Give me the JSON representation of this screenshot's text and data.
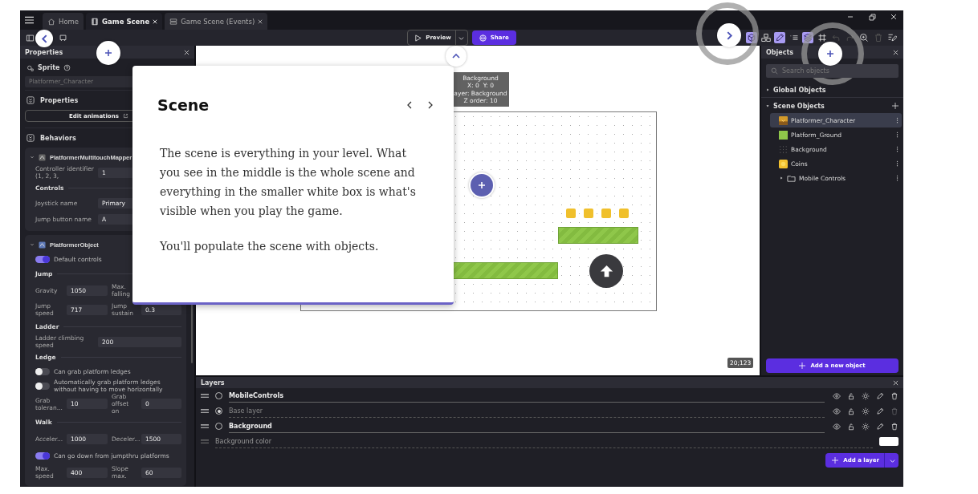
{
  "tabs": [
    {
      "label": "Home",
      "selected": false,
      "closable": false
    },
    {
      "label": "Game Scene",
      "selected": true,
      "closable": true
    },
    {
      "label": "Game Scene (Events)",
      "selected": false,
      "closable": true
    }
  ],
  "toolbar": {
    "preview_label": "Preview",
    "share_label": "Share",
    "tools": [
      {
        "active": true,
        "disabled": false
      },
      {
        "active": false,
        "disabled": false
      },
      {
        "active": true,
        "disabled": false
      },
      {
        "active": false,
        "disabled": false
      },
      {
        "active": true,
        "disabled": false
      },
      {
        "active": false,
        "disabled": false
      },
      {
        "active": false,
        "disabled": true
      },
      {
        "active": false,
        "disabled": true
      },
      {
        "active": false,
        "disabled": false
      },
      {
        "active": false,
        "disabled": true
      },
      {
        "active": false,
        "disabled": false
      }
    ]
  },
  "properties": {
    "title": "Properties",
    "object_type": "Sprite",
    "object_name": "Platformer_Character",
    "section_title": "Properties",
    "edit_button": "Edit animations",
    "behaviors_title": "Behaviors",
    "behaviors": [
      {
        "name": "PlatformerMultitouchMapper",
        "rows": [
          {
            "kind": "field",
            "label": "Controller identifier (1, 2, 3,",
            "value": "1"
          },
          {
            "kind": "heading",
            "label": "Controls"
          },
          {
            "kind": "field",
            "label": "Joystick name",
            "value": "Primary"
          },
          {
            "kind": "field",
            "label": "Jump button name",
            "value": "A"
          }
        ]
      },
      {
        "name": "PlatformerObject",
        "rows": [
          {
            "kind": "toggle",
            "label": "Default controls",
            "on": true
          },
          {
            "kind": "heading",
            "label": "Jump"
          },
          {
            "kind": "pair",
            "fields": [
              {
                "label": "Gravity",
                "value": "1050"
              },
              {
                "label": "Max. falling"
              }
            ]
          },
          {
            "kind": "pair",
            "fields": [
              {
                "label": "Jump speed",
                "value": "717"
              },
              {
                "label": "Jump sustain",
                "value": "0.3"
              }
            ]
          },
          {
            "kind": "heading",
            "label": "Ladder"
          },
          {
            "kind": "field",
            "label": "Ladder climbing speed",
            "value": "200"
          },
          {
            "kind": "heading",
            "label": "Ledge"
          },
          {
            "kind": "toggle",
            "label": "Can grab platform ledges",
            "on": false
          },
          {
            "kind": "toggle",
            "label": "Automatically grab platform ledges without having to move horizontally",
            "on": false
          },
          {
            "kind": "pair",
            "fields": [
              {
                "label": "Grab toleran...",
                "value": "10"
              },
              {
                "label": "Grab offset on",
                "value": "0"
              }
            ]
          },
          {
            "kind": "heading",
            "label": "Walk"
          },
          {
            "kind": "pair",
            "fields": [
              {
                "label": "Acceler...",
                "value": "1000"
              },
              {
                "label": "Deceler...",
                "value": "1500"
              }
            ]
          },
          {
            "kind": "toggle",
            "label": "Can go down from jumpthru platforms",
            "on": true
          },
          {
            "kind": "pair",
            "fields": [
              {
                "label": "Max. speed",
                "value": "400"
              },
              {
                "label": "Slope max.",
                "value": "60"
              }
            ]
          }
        ]
      }
    ]
  },
  "scene_editor": {
    "tooltip": [
      "Background",
      "X: 0  Y: 0",
      "ayer: Background",
      "Z order: 10"
    ],
    "coordinates": "20;123"
  },
  "objects": {
    "title": "Objects",
    "search_placeholder": "Search objects",
    "groups": [
      {
        "label": "Global Objects",
        "expanded": false
      },
      {
        "label": "Scene Objects",
        "expanded": true,
        "items": [
          {
            "name": "Platformer_Character",
            "kind": "character",
            "selected": true
          },
          {
            "name": "Platform_Ground",
            "kind": "ground",
            "selected": false
          },
          {
            "name": "Background",
            "kind": "background",
            "selected": false
          },
          {
            "name": "Coins",
            "kind": "coin",
            "selected": false
          },
          {
            "name": "Mobile Controls",
            "kind": "folder",
            "selected": false,
            "expanded": false
          }
        ]
      }
    ],
    "add_button": "Add a new object"
  },
  "layers": {
    "title": "Layers",
    "items": [
      {
        "name": "MobileControls",
        "kind": "custom",
        "selected": false
      },
      {
        "name": "Base layer",
        "kind": "base",
        "selected": true
      },
      {
        "name": "Background",
        "kind": "custom",
        "selected": false
      }
    ],
    "background_color_label": "Background color",
    "add_button": "Add a layer"
  },
  "tutorial": {
    "title": "Scene",
    "paragraphs": [
      "The scene is everything in your level. What you see in the middle is the whole scene and everything in the smaller white box is what's visible when you play the game.",
      "You'll populate the scene with objects."
    ]
  }
}
